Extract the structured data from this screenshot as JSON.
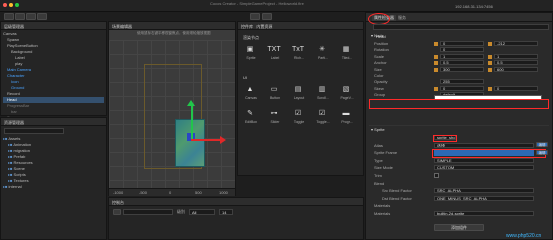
{
  "app": {
    "title": "Cocos Creator - SimpleGameProject - Helloworld.fire",
    "ip": "192.168.31.134:7456"
  },
  "hierarchy": {
    "tab": "层级管理器",
    "items": [
      {
        "label": "Canvas",
        "indent": 0,
        "color": "#bbbbbb"
      },
      {
        "label": "Spawn",
        "indent": 1,
        "color": "#bbbbbb"
      },
      {
        "label": "PlaySceneButton",
        "indent": 1,
        "color": "#bbbbbb"
      },
      {
        "label": "Background",
        "indent": 2,
        "color": "#bbbbbb"
      },
      {
        "label": "Label",
        "indent": 3,
        "color": "#bbbbbb"
      },
      {
        "label": "play",
        "indent": 3,
        "color": "#bbbbbb"
      },
      {
        "label": "Main Camera",
        "indent": 1,
        "color": "#4aa3ff"
      },
      {
        "label": "Character",
        "indent": 1,
        "color": "#4aa3ff"
      },
      {
        "label": "Icon",
        "indent": 2,
        "color": "#4aa3ff"
      },
      {
        "label": "Ground",
        "indent": 2,
        "color": "#4aa3ff"
      },
      {
        "label": "Record",
        "indent": 1,
        "color": "#bbbbbb"
      },
      {
        "label": "Head",
        "indent": 1,
        "color": "#ffffff"
      },
      {
        "label": "ProgressBar",
        "indent": 1,
        "color": "#777777"
      },
      {
        "label": "bar",
        "indent": 2,
        "color": "#777777"
      },
      {
        "label": "Score",
        "indent": 1,
        "color": "#777777"
      }
    ]
  },
  "assets": {
    "tab": "资源管理器",
    "items": [
      {
        "label": "Assets",
        "indent": 0
      },
      {
        "label": "Animation",
        "indent": 1
      },
      {
        "label": "migration",
        "indent": 1
      },
      {
        "label": "Prefab",
        "indent": 1
      },
      {
        "label": "Resources",
        "indent": 1
      },
      {
        "label": "Scene",
        "indent": 1
      },
      {
        "label": "Scripts",
        "indent": 1
      },
      {
        "label": "Textures",
        "indent": 1
      },
      {
        "label": "internal",
        "indent": 0
      }
    ]
  },
  "scene": {
    "tab": "场景编辑器",
    "hint": "使用鼠标右键平移视窗焦点，使用滚轮缩放视图",
    "ruler_bottom": [
      "-1000",
      "-500",
      "0",
      "500",
      "1000"
    ]
  },
  "widgets": {
    "tabs": [
      "控件库",
      "内置资源"
    ],
    "section1": "渲染节点",
    "row1": [
      {
        "label": "Sprite",
        "glyph": "▣"
      },
      {
        "label": "Label",
        "glyph": "TXT"
      },
      {
        "label": "Rich...",
        "glyph": "TxT"
      },
      {
        "label": "Parti...",
        "glyph": "✳"
      },
      {
        "label": "Tiled...",
        "glyph": "▦"
      }
    ],
    "section2": "UI",
    "row2": [
      {
        "label": "Canvas",
        "glyph": "▲"
      },
      {
        "label": "Button",
        "glyph": "▭"
      },
      {
        "label": "Layout",
        "glyph": "▤"
      },
      {
        "label": "Scroll...",
        "glyph": "▥"
      },
      {
        "label": "PageV...",
        "glyph": "▧"
      }
    ],
    "row3": [
      {
        "label": "EditBox",
        "glyph": "✎"
      },
      {
        "label": "Slider",
        "glyph": "⊶"
      },
      {
        "label": "Toggle",
        "glyph": "☑"
      },
      {
        "label": "Toggle...",
        "glyph": "☑"
      },
      {
        "label": "Progr...",
        "glyph": "▬"
      }
    ]
  },
  "console": {
    "tab": "控制台",
    "filter_label": "级别",
    "filter_value": "All",
    "search_placeholder": "",
    "font_size": "14"
  },
  "inspector": {
    "tab": "属性检查器",
    "tab2": "服务",
    "node_name": "Head",
    "props": [
      {
        "label": "Position",
        "x": "0",
        "y": "-212",
        "chip": "X"
      },
      {
        "label": "Rotation",
        "x": "0",
        "y": "",
        "chip": ""
      },
      {
        "label": "Scale",
        "x": "1",
        "y": "1",
        "chip": "X"
      },
      {
        "label": "Anchor",
        "x": "0.5",
        "y": "0.5",
        "chip": "X"
      },
      {
        "label": "Size",
        "x": "300",
        "y": "600",
        "chip": "W"
      },
      {
        "label": "Color",
        "x": "",
        "y": "",
        "chip": ""
      },
      {
        "label": "Opacity",
        "x": "255",
        "y": "",
        "chip": ""
      },
      {
        "label": "Skew",
        "x": "0",
        "y": "0",
        "chip": "X"
      },
      {
        "label": "Group",
        "x": "default",
        "y": "",
        "chip": ""
      }
    ],
    "sprite_section": "Sprite",
    "sprite_props": [
      {
        "label": "",
        "value": "sprite_show.j"
      },
      {
        "label": "Atlas",
        "value": "选择"
      },
      {
        "label": "Sprite Frame",
        "value": "sprite_frame"
      },
      {
        "label": "Type",
        "value": "SIMPLE"
      },
      {
        "label": "Size Mode",
        "value": "CUSTOM"
      },
      {
        "label": "Trim",
        "value": ""
      },
      {
        "label": "Blend",
        "value": ""
      },
      {
        "label": "Src Blend Factor",
        "value": "SRC_ALPHA"
      },
      {
        "label": "Dst Blend Factor",
        "value": "ONE_MINUS_SRC_ALPHA"
      },
      {
        "label": "Materials",
        "value": ""
      },
      {
        "label": "Materials",
        "value": "builtin-2d-sprite"
      }
    ],
    "add_component": "添加组件",
    "edit_btn": "编辑",
    "watermark": "www.php520.cn"
  },
  "colors": {
    "accent": "#4aa3ff",
    "selection": "#2b6ab5",
    "red": "#ff2a2a",
    "gizmo_green": "#21c64a",
    "gizmo_red": "#e02828"
  }
}
